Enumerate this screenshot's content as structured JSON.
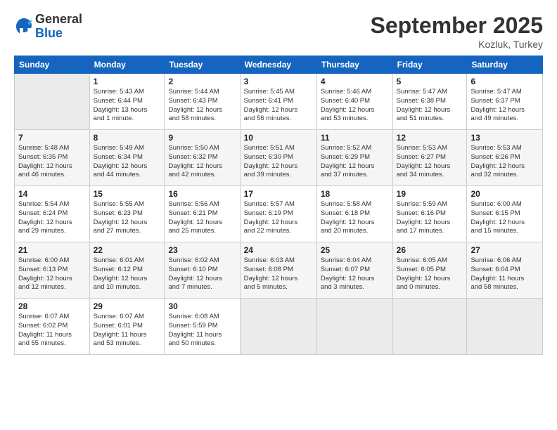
{
  "logo": {
    "general": "General",
    "blue": "Blue"
  },
  "title": "September 2025",
  "subtitle": "Kozluk, Turkey",
  "days_header": [
    "Sunday",
    "Monday",
    "Tuesday",
    "Wednesday",
    "Thursday",
    "Friday",
    "Saturday"
  ],
  "weeks": [
    [
      {
        "num": "",
        "info": ""
      },
      {
        "num": "1",
        "info": "Sunrise: 5:43 AM\nSunset: 6:44 PM\nDaylight: 13 hours\nand 1 minute."
      },
      {
        "num": "2",
        "info": "Sunrise: 5:44 AM\nSunset: 6:43 PM\nDaylight: 12 hours\nand 58 minutes."
      },
      {
        "num": "3",
        "info": "Sunrise: 5:45 AM\nSunset: 6:41 PM\nDaylight: 12 hours\nand 56 minutes."
      },
      {
        "num": "4",
        "info": "Sunrise: 5:46 AM\nSunset: 6:40 PM\nDaylight: 12 hours\nand 53 minutes."
      },
      {
        "num": "5",
        "info": "Sunrise: 5:47 AM\nSunset: 6:38 PM\nDaylight: 12 hours\nand 51 minutes."
      },
      {
        "num": "6",
        "info": "Sunrise: 5:47 AM\nSunset: 6:37 PM\nDaylight: 12 hours\nand 49 minutes."
      }
    ],
    [
      {
        "num": "7",
        "info": "Sunrise: 5:48 AM\nSunset: 6:35 PM\nDaylight: 12 hours\nand 46 minutes."
      },
      {
        "num": "8",
        "info": "Sunrise: 5:49 AM\nSunset: 6:34 PM\nDaylight: 12 hours\nand 44 minutes."
      },
      {
        "num": "9",
        "info": "Sunrise: 5:50 AM\nSunset: 6:32 PM\nDaylight: 12 hours\nand 42 minutes."
      },
      {
        "num": "10",
        "info": "Sunrise: 5:51 AM\nSunset: 6:30 PM\nDaylight: 12 hours\nand 39 minutes."
      },
      {
        "num": "11",
        "info": "Sunrise: 5:52 AM\nSunset: 6:29 PM\nDaylight: 12 hours\nand 37 minutes."
      },
      {
        "num": "12",
        "info": "Sunrise: 5:53 AM\nSunset: 6:27 PM\nDaylight: 12 hours\nand 34 minutes."
      },
      {
        "num": "13",
        "info": "Sunrise: 5:53 AM\nSunset: 6:26 PM\nDaylight: 12 hours\nand 32 minutes."
      }
    ],
    [
      {
        "num": "14",
        "info": "Sunrise: 5:54 AM\nSunset: 6:24 PM\nDaylight: 12 hours\nand 29 minutes."
      },
      {
        "num": "15",
        "info": "Sunrise: 5:55 AM\nSunset: 6:23 PM\nDaylight: 12 hours\nand 27 minutes."
      },
      {
        "num": "16",
        "info": "Sunrise: 5:56 AM\nSunset: 6:21 PM\nDaylight: 12 hours\nand 25 minutes."
      },
      {
        "num": "17",
        "info": "Sunrise: 5:57 AM\nSunset: 6:19 PM\nDaylight: 12 hours\nand 22 minutes."
      },
      {
        "num": "18",
        "info": "Sunrise: 5:58 AM\nSunset: 6:18 PM\nDaylight: 12 hours\nand 20 minutes."
      },
      {
        "num": "19",
        "info": "Sunrise: 5:59 AM\nSunset: 6:16 PM\nDaylight: 12 hours\nand 17 minutes."
      },
      {
        "num": "20",
        "info": "Sunrise: 6:00 AM\nSunset: 6:15 PM\nDaylight: 12 hours\nand 15 minutes."
      }
    ],
    [
      {
        "num": "21",
        "info": "Sunrise: 6:00 AM\nSunset: 6:13 PM\nDaylight: 12 hours\nand 12 minutes."
      },
      {
        "num": "22",
        "info": "Sunrise: 6:01 AM\nSunset: 6:12 PM\nDaylight: 12 hours\nand 10 minutes."
      },
      {
        "num": "23",
        "info": "Sunrise: 6:02 AM\nSunset: 6:10 PM\nDaylight: 12 hours\nand 7 minutes."
      },
      {
        "num": "24",
        "info": "Sunrise: 6:03 AM\nSunset: 6:08 PM\nDaylight: 12 hours\nand 5 minutes."
      },
      {
        "num": "25",
        "info": "Sunrise: 6:04 AM\nSunset: 6:07 PM\nDaylight: 12 hours\nand 3 minutes."
      },
      {
        "num": "26",
        "info": "Sunrise: 6:05 AM\nSunset: 6:05 PM\nDaylight: 12 hours\nand 0 minutes."
      },
      {
        "num": "27",
        "info": "Sunrise: 6:06 AM\nSunset: 6:04 PM\nDaylight: 11 hours\nand 58 minutes."
      }
    ],
    [
      {
        "num": "28",
        "info": "Sunrise: 6:07 AM\nSunset: 6:02 PM\nDaylight: 11 hours\nand 55 minutes."
      },
      {
        "num": "29",
        "info": "Sunrise: 6:07 AM\nSunset: 6:01 PM\nDaylight: 11 hours\nand 53 minutes."
      },
      {
        "num": "30",
        "info": "Sunrise: 6:08 AM\nSunset: 5:59 PM\nDaylight: 11 hours\nand 50 minutes."
      },
      {
        "num": "",
        "info": ""
      },
      {
        "num": "",
        "info": ""
      },
      {
        "num": "",
        "info": ""
      },
      {
        "num": "",
        "info": ""
      }
    ]
  ]
}
